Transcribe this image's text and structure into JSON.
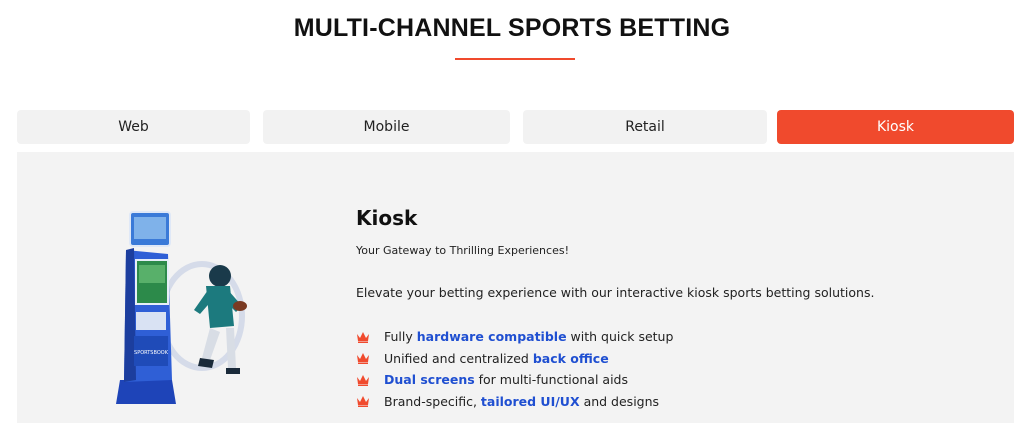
{
  "section": {
    "title": "MULTI-CHANNEL SPORTS BETTING"
  },
  "tabs": [
    {
      "label": "Web",
      "active": false
    },
    {
      "label": "Mobile",
      "active": false
    },
    {
      "label": "Retail",
      "active": false
    },
    {
      "label": "Kiosk",
      "active": true
    }
  ],
  "colors": {
    "accent": "#f04a2d",
    "link_highlight": "#1f4fd1",
    "panel_bg": "#f3f3f3",
    "tab_bg": "#f2f2f2"
  },
  "content": {
    "title": "Kiosk",
    "tagline": "Your Gateway to Thrilling Experiences!",
    "description": "Elevate your betting experience with our interactive kiosk sports betting solutions.",
    "bullet_icon": "crown-icon",
    "features": [
      {
        "pre": "Fully ",
        "highlight": "hardware compatible",
        "post": " with quick setup"
      },
      {
        "pre": "Unified and centralized ",
        "highlight": "back office",
        "post": ""
      },
      {
        "pre": "",
        "highlight": "Dual screens",
        "post": " for multi-functional aids"
      },
      {
        "pre": "Brand-specific, ",
        "highlight": "tailored UI/UX",
        "post": " and designs"
      }
    ]
  },
  "illustration": {
    "kiosk_brand_text": "SPORTSBOOK"
  }
}
